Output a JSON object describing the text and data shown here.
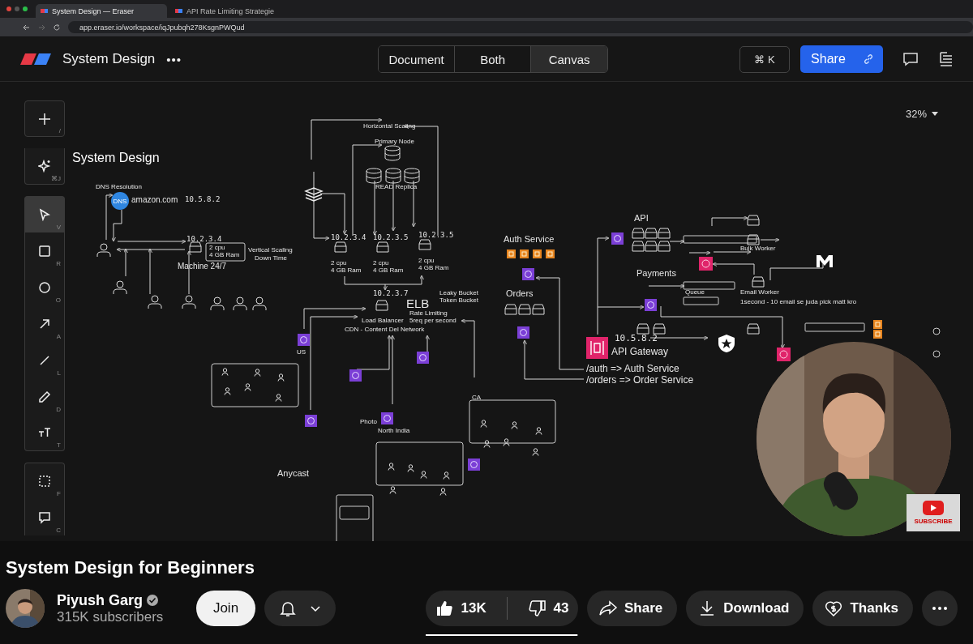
{
  "browser": {
    "tabs": [
      {
        "title": "System Design — Eraser",
        "selected": true
      },
      {
        "title": "API Rate Limiting Strategie",
        "selected": false
      }
    ],
    "url": "app.eraser.io/workspace/iqJpubqh278KsgnPWQud"
  },
  "app": {
    "title": "System Design",
    "menu": "•••",
    "views": [
      {
        "label": "Document",
        "selected": false
      },
      {
        "label": "Both",
        "selected": false
      },
      {
        "label": "Canvas",
        "selected": true
      }
    ],
    "command": "⌘ K",
    "share": "Share",
    "zoom": "32%"
  },
  "tools": [
    {
      "kind": "add",
      "shortcut": "/",
      "selected": false
    },
    {
      "kind": "ai",
      "shortcut": "⌘J",
      "selected": false
    },
    {
      "kind": "select",
      "shortcut": "V",
      "selected": true
    },
    {
      "kind": "rectangle",
      "shortcut": "R",
      "selected": false
    },
    {
      "kind": "ellipse",
      "shortcut": "O",
      "selected": false
    },
    {
      "kind": "arrow",
      "shortcut": "A",
      "selected": false
    },
    {
      "kind": "line",
      "shortcut": "L",
      "selected": false
    },
    {
      "kind": "pen",
      "shortcut": "D",
      "selected": false
    },
    {
      "kind": "text",
      "shortcut": "T",
      "selected": false
    },
    {
      "kind": "frame",
      "shortcut": "F",
      "selected": false
    },
    {
      "kind": "comment",
      "shortcut": "C",
      "selected": false
    }
  ],
  "diagram": {
    "dns_badge": "DNS",
    "labels": [
      "System Design",
      "DNS Resolution",
      "amazon.com",
      "10.5.8.2",
      "10.2.3.4",
      "2 cpu",
      "4 GB Ram",
      "Vertical Scaling",
      "Down Time",
      "Machine 24/7",
      "Horizontal Scaling",
      "Primary Node",
      "READ Replica",
      "10.2.3.4",
      "10.2.3.5",
      "10.2.3.5",
      "2 cpu",
      "4 GB Ram",
      "2 cpu",
      "4 GB Ram",
      "2 cpu",
      "4 GB Ram",
      "10.2.3.7",
      "Leaky Bucket",
      "Token Bucket",
      "ELB",
      "Rate Limiting",
      "Load Balancer",
      "5req per second",
      "CDN - Content Del Network",
      "US",
      "Photo",
      "North India",
      "CA",
      "Anycast",
      "Auth Service",
      "Orders",
      "API",
      "Bulk Worker",
      "Payments",
      "Queue",
      "Email Worker",
      "1second - 10 email se juda pick matt kro",
      "10.5.8.2",
      "API Gateway",
      "/auth => Auth Service",
      "/orders => Order Service"
    ]
  },
  "overlay": {
    "subscribe": "SUBSCRIBE"
  },
  "video": {
    "title": "System Design for Beginners",
    "channel": {
      "name": "Piyush Garg",
      "verified": true,
      "subscribers": "315K subscribers"
    },
    "join": "Join",
    "likes": "13K",
    "dislikes": "43",
    "rating": {
      "level": 0.997
    },
    "share": "Share",
    "download": "Download",
    "thanks": "Thanks"
  }
}
